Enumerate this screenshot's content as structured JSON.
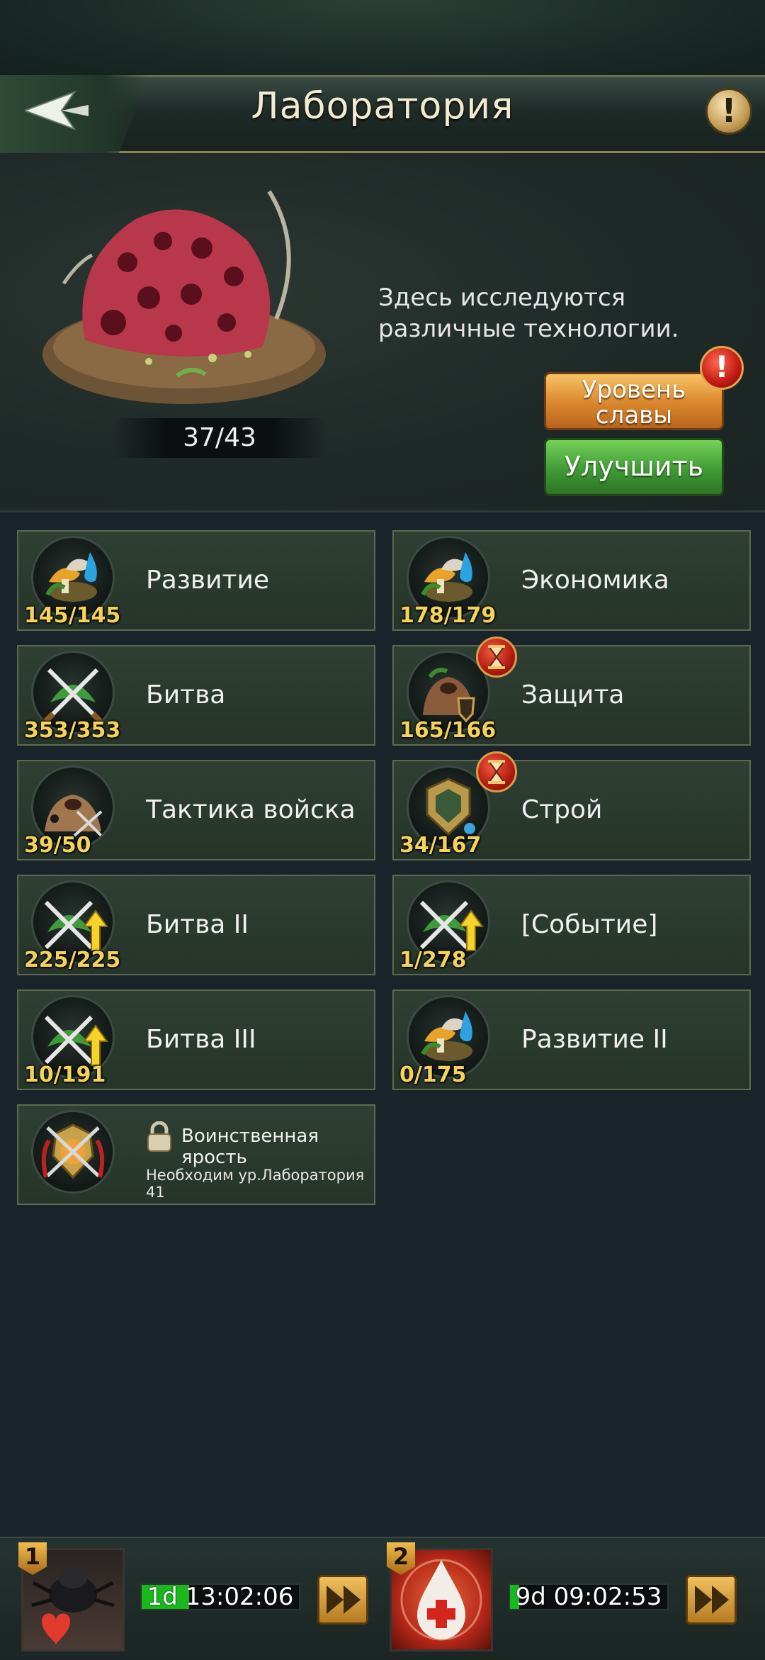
{
  "header": {
    "title": "Лаборатория",
    "back_icon": "back-arrow-icon",
    "info_icon": "info-icon",
    "info_symbol": "!"
  },
  "building": {
    "image_icon": "laboratory-coral-icon",
    "progress": "37/43",
    "description": "Здесь исследуются различные технологии.",
    "glory_button": "Уровень славы",
    "glory_alert": "!",
    "upgrade_button": "Улучшить"
  },
  "categories": [
    {
      "label": "Развитие",
      "count": "145/145",
      "icon": "mushroom-water-icon"
    },
    {
      "label": "Экономика",
      "count": "178/179",
      "icon": "mushroom-water-icon"
    },
    {
      "label": "Битва",
      "count": "353/353",
      "icon": "crossed-swords-icon"
    },
    {
      "label": "Защита",
      "count": "165/166",
      "icon": "anthill-shield-icon",
      "timer": true
    },
    {
      "label": "Тактика войска",
      "count": "39/50",
      "icon": "anthill-swords-icon"
    },
    {
      "label": "Строй",
      "count": "34/167",
      "icon": "formation-crest-icon",
      "timer": true
    },
    {
      "label": "Битва II",
      "count": "225/225",
      "icon": "swords-up-arrow-icon"
    },
    {
      "label": "[Событие]",
      "count": "1/278",
      "icon": "swords-up-arrow-icon"
    },
    {
      "label": "Битва III",
      "count": "10/191",
      "icon": "swords-up-arrow-icon"
    },
    {
      "label": "Развитие II",
      "count": "0/175",
      "icon": "mushroom-water-icon"
    }
  ],
  "locked": {
    "label": "Воинственная ярость",
    "requirement": "Необходим ур.Лаборатория 41",
    "icon": "war-fury-emblem-icon",
    "lock_icon": "lock-icon"
  },
  "queues": [
    {
      "slot": "1",
      "timer": "1d 13:02:06",
      "progress": 0.3,
      "icon": "beetle-heart-icon"
    },
    {
      "slot": "2",
      "timer": "9d 09:02:53",
      "progress": 0.05,
      "icon": "blood-drop-heal-icon"
    }
  ],
  "colors": {
    "accent_gold": "#f5d25a",
    "green_button": "#3f9b34",
    "orange_button": "#d9862c"
  }
}
